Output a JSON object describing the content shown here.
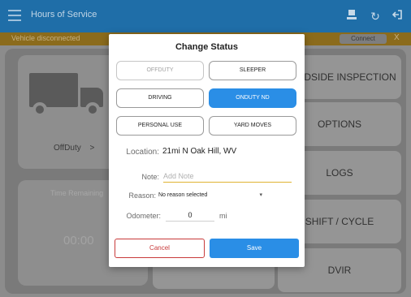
{
  "appbar": {
    "title": "Hours of Service",
    "icons": [
      "menu-icon",
      "driver-icon",
      "refresh-icon",
      "logout-icon"
    ]
  },
  "strip": {
    "message": "Vehicle disconnected",
    "connect_label": "Connect",
    "close_label": "X"
  },
  "dashboard": {
    "status_label": "OffDuty",
    "chevron": ">",
    "time_remaining_label": "Time Remaining",
    "time_value": "00:00",
    "menu": [
      "ROADSIDE INSPECTION",
      "OPTIONS",
      "LOGS",
      "SHIFT / CYCLE",
      "DVIR"
    ]
  },
  "dialog": {
    "title": "Change Status",
    "buttons": {
      "offduty": "OFFDUTY",
      "sleeper": "SLEEPER",
      "driving": "DRIVING",
      "onduty_nd": "ONDUTY ND",
      "personal_use": "PERSONAL USE",
      "yard_moves": "YARD MOVES"
    },
    "location_label": "Location:",
    "location_value": "21mi N Oak Hill, WV",
    "note_label": "Note:",
    "note_placeholder": "Add Note",
    "reason_label": "Reason:",
    "reason_value": "No reason selected",
    "odometer_label": "Odometer:",
    "odometer_value": "0",
    "odometer_unit": "mi",
    "cancel_label": "Cancel",
    "save_label": "Save"
  },
  "colors": {
    "appbar": "#1f6ea8",
    "strip": "#8b6b1c",
    "accent": "#2a8ee6",
    "cancel": "#c83a3a",
    "note_underline": "#e0b332"
  }
}
